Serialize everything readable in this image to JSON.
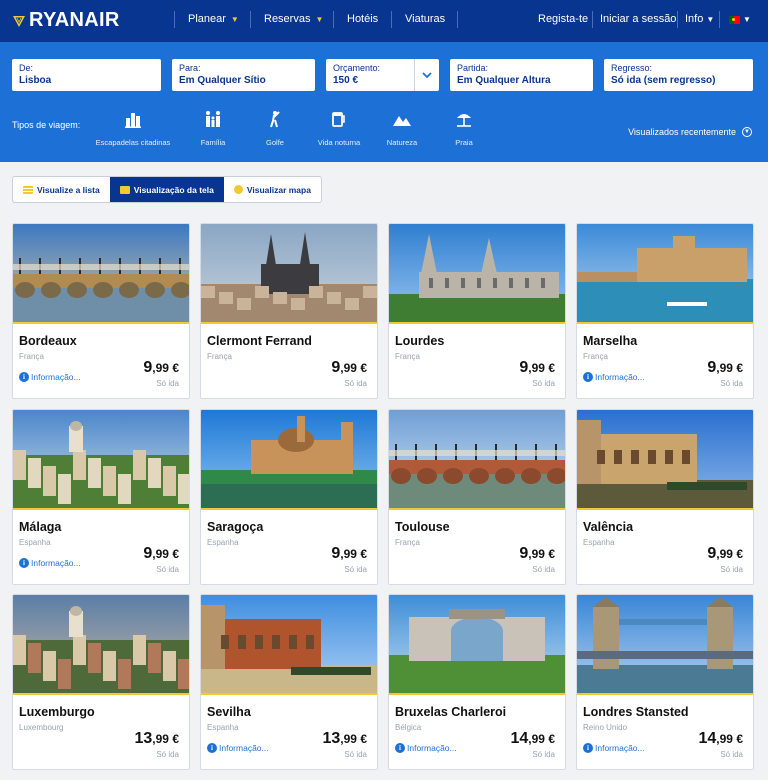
{
  "brand": {
    "name": "RYANAIR"
  },
  "nav": {
    "items": [
      {
        "label": "Planear",
        "caret": true
      },
      {
        "label": "Reservas",
        "caret": true
      },
      {
        "label": "Hotéis",
        "caret": false
      },
      {
        "label": "Viaturas",
        "caret": false
      }
    ],
    "register": "Regista-te",
    "login": "Iniciar a sessão",
    "info": "Info",
    "language_flag": "portugal-flag-icon"
  },
  "search": {
    "from": {
      "label": "De:",
      "value": "Lisboa"
    },
    "to": {
      "label": "Para:",
      "value": "Em Qualquer Sítio"
    },
    "budget": {
      "label": "Orçamento:",
      "value": "150 €"
    },
    "departure": {
      "label": "Partida:",
      "value": "Em Qualquer Altura"
    },
    "return": {
      "label": "Regresso:",
      "value": "Só ida (sem regresso)"
    },
    "trip_types_label": "Tipos de viagem:",
    "trip_types": [
      {
        "label": "Escapadelas citadinas",
        "icon": "city-icon"
      },
      {
        "label": "Família",
        "icon": "family-icon"
      },
      {
        "label": "Golfe",
        "icon": "golf-icon"
      },
      {
        "label": "Vida noturna",
        "icon": "nightlife-icon"
      },
      {
        "label": "Natureza",
        "icon": "mountain-icon"
      },
      {
        "label": "Praia",
        "icon": "beach-icon"
      }
    ],
    "recently_viewed": "Visualizados recentemente"
  },
  "views": {
    "list": "Visualize a lista",
    "grid": "Visualização da tela",
    "map": "Visualizar mapa",
    "active": "grid"
  },
  "destinations": [
    {
      "city": "Bordeaux",
      "country": "França",
      "info": "Informação...",
      "price_int": "9",
      "price_dec": ",99 €",
      "oneway": "Só ida"
    },
    {
      "city": "Clermont Ferrand",
      "country": "França",
      "info": "",
      "price_int": "9",
      "price_dec": ",99 €",
      "oneway": "Só ida"
    },
    {
      "city": "Lourdes",
      "country": "França",
      "info": "",
      "price_int": "9",
      "price_dec": ",99 €",
      "oneway": "Só ida"
    },
    {
      "city": "Marselha",
      "country": "França",
      "info": "Informação...",
      "price_int": "9",
      "price_dec": ",99 €",
      "oneway": "Só ida"
    },
    {
      "city": "Málaga",
      "country": "Espanha",
      "info": "Informação...",
      "price_int": "9",
      "price_dec": ",99 €",
      "oneway": "Só ida"
    },
    {
      "city": "Saragoça",
      "country": "Espanha",
      "info": "",
      "price_int": "9",
      "price_dec": ",99 €",
      "oneway": "Só ida"
    },
    {
      "city": "Toulouse",
      "country": "França",
      "info": "",
      "price_int": "9",
      "price_dec": ",99 €",
      "oneway": "Só ida"
    },
    {
      "city": "Valência",
      "country": "Espanha",
      "info": "",
      "price_int": "9",
      "price_dec": ",99 €",
      "oneway": "Só ida"
    },
    {
      "city": "Luxemburgo",
      "country": "Luxembourg",
      "info": "",
      "price_int": "13",
      "price_dec": ",99 €",
      "oneway": "Só ida"
    },
    {
      "city": "Sevilha",
      "country": "Espanha",
      "info": "Informação...",
      "price_int": "13",
      "price_dec": ",99 €",
      "oneway": "Só ida"
    },
    {
      "city": "Bruxelas Charleroi",
      "country": "Bélgica",
      "info": "Informação...",
      "price_int": "14",
      "price_dec": ",99 €",
      "oneway": "Só ida"
    },
    {
      "city": "Londres Stansted",
      "country": "Reino Unido",
      "info": "Informação...",
      "price_int": "14",
      "price_dec": ",99 €",
      "oneway": "Só ida"
    }
  ],
  "colors": {
    "brand_navy": "#073590",
    "search_blue": "#1d71d6",
    "accent_yellow": "#f1c933",
    "link_blue": "#1d71d6"
  }
}
